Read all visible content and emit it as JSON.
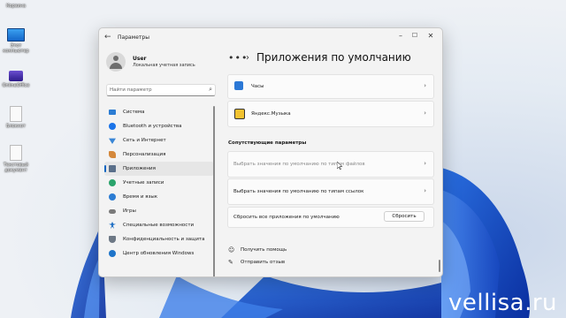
{
  "desktop": {
    "icons": [
      {
        "label": "Корзина",
        "icon": "recycle-bin"
      },
      {
        "label": "Этот компьютер",
        "icon": "computer"
      },
      {
        "label": "OnlineOffice",
        "icon": "app"
      },
      {
        "label": "Блокнот",
        "icon": "document"
      },
      {
        "label": "Текстовый документ",
        "icon": "document"
      }
    ],
    "watermark": "vellisa.ru"
  },
  "window": {
    "title": "Параметры",
    "back_icon": "back-arrow",
    "controls": [
      "minimize",
      "maximize",
      "close"
    ]
  },
  "profile": {
    "name": "User",
    "account_type": "Локальная учетная запись"
  },
  "search": {
    "placeholder": "Найти параметр",
    "icon": "search-icon"
  },
  "nav": {
    "items": [
      {
        "label": "Система",
        "icon": "monitor",
        "color": "#2b7cd3"
      },
      {
        "label": "Bluetooth и устройства",
        "icon": "bluetooth",
        "color": "#1a73e8"
      },
      {
        "label": "Сеть и Интернет",
        "icon": "wifi",
        "color": "#3a86d6"
      },
      {
        "label": "Персонализация",
        "icon": "brush",
        "color": "#d4883b"
      },
      {
        "label": "Приложения",
        "icon": "apps",
        "color": "#5a6f8a",
        "active": true
      },
      {
        "label": "Учетные записи",
        "icon": "person",
        "color": "#2aa36b"
      },
      {
        "label": "Время и язык",
        "icon": "globe-clock",
        "color": "#2b7cd3"
      },
      {
        "label": "Игры",
        "icon": "gamepad",
        "color": "#7a7a7a"
      },
      {
        "label": "Специальные возможности",
        "icon": "accessibility",
        "color": "#1f6fc4"
      },
      {
        "label": "Конфиденциальность и защита",
        "icon": "shield",
        "color": "#6d7885"
      },
      {
        "label": "Центр обновления Windows",
        "icon": "update",
        "color": "#1e74c9"
      }
    ]
  },
  "main": {
    "breadcrumb_more": "•••",
    "title": "Приложения по умолчанию",
    "apps": [
      {
        "label": "Часы",
        "icon": "clock-app",
        "color": "#2b78d6"
      },
      {
        "label": "Яндекс.Музыка",
        "icon": "yandex-music-app",
        "color": "#f2c230"
      }
    ],
    "related_title": "Сопутствующие параметры",
    "related": [
      {
        "label": "Выбрать значения по умолчанию по типам файлов",
        "dim": true
      },
      {
        "label": "Выбрать значения по умолчанию по типам ссылок",
        "dim": false
      }
    ],
    "reset": {
      "label": "Сбросить все приложения по умолчанию",
      "button": "Сбросить"
    },
    "links": [
      {
        "label": "Получить помощь",
        "icon": "help-icon"
      },
      {
        "label": "Отправить отзыв",
        "icon": "feedback-icon"
      }
    ]
  }
}
